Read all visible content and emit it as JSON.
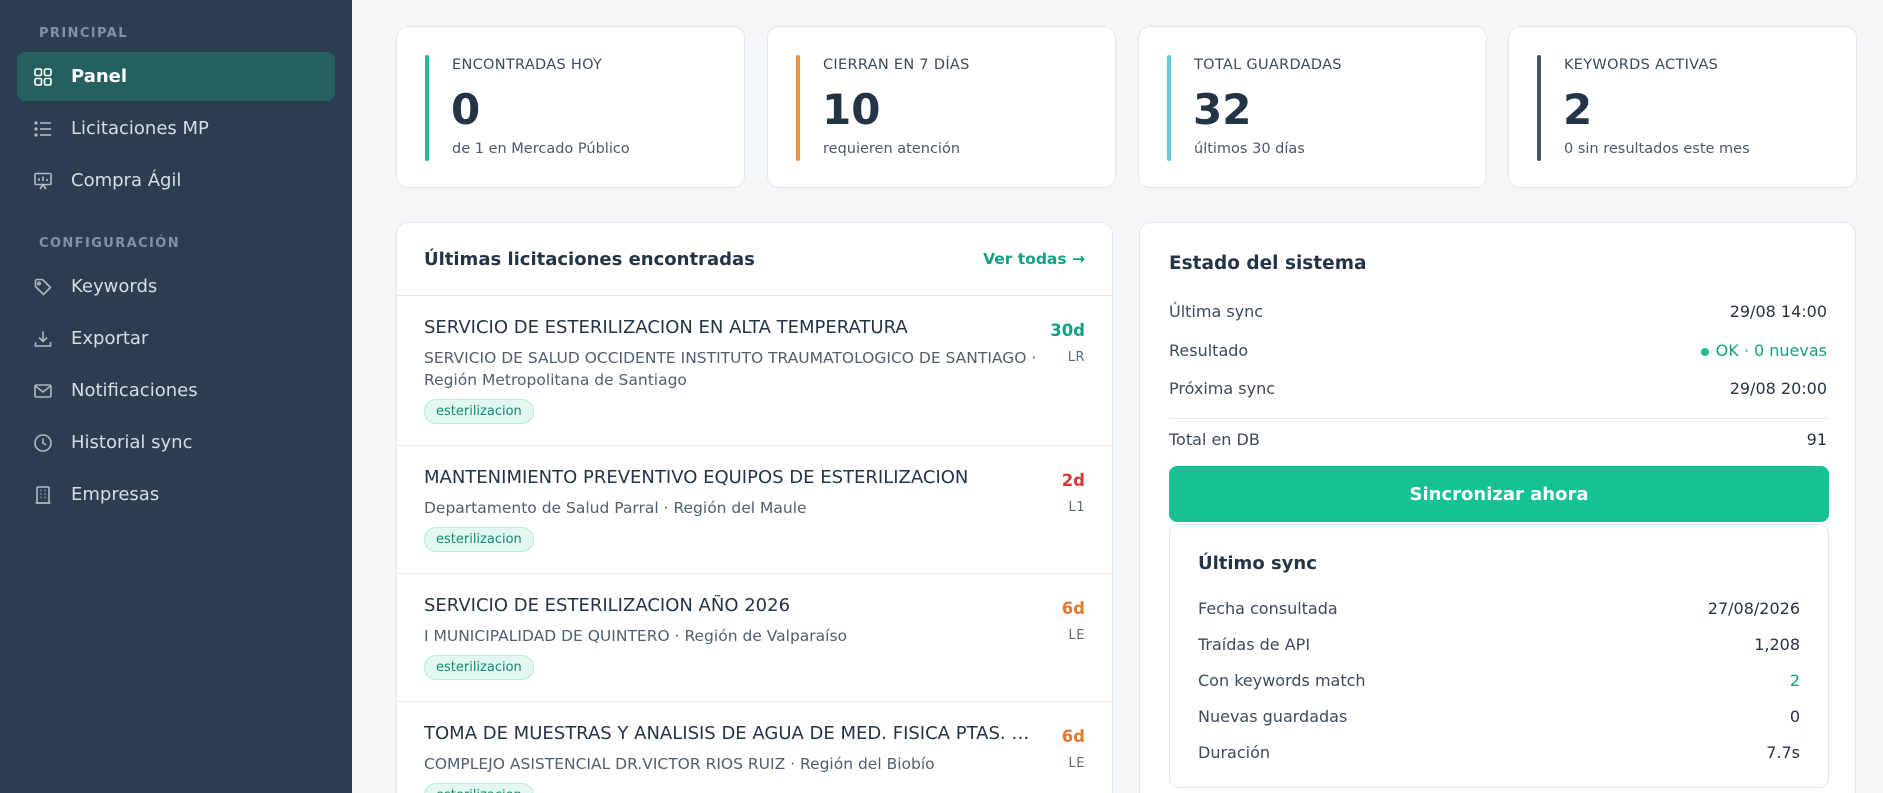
{
  "sidebar": {
    "sections": {
      "principal": "PRINCIPAL",
      "config": "CONFIGURACIÓN"
    },
    "items": [
      {
        "label": "Panel",
        "icon": "grid-icon",
        "active": true
      },
      {
        "label": "Licitaciones MP",
        "icon": "list-icon"
      },
      {
        "label": "Compra Ágil",
        "icon": "presentation-icon"
      },
      {
        "label": "Keywords",
        "icon": "tag-icon"
      },
      {
        "label": "Exportar",
        "icon": "download-icon"
      },
      {
        "label": "Notificaciones",
        "icon": "mail-icon"
      },
      {
        "label": "Historial sync",
        "icon": "clock-icon"
      },
      {
        "label": "Empresas",
        "icon": "building-icon"
      }
    ]
  },
  "stats": [
    {
      "label": "ENCONTRADAS HOY",
      "value": "0",
      "sub": "de 1 en Mercado Público",
      "color": "#1bbf8e"
    },
    {
      "label": "CIERRAN EN 7 DÍAS",
      "value": "10",
      "sub": "requieren atención",
      "color": "#f0913f"
    },
    {
      "label": "TOTAL GUARDADAS",
      "value": "32",
      "sub": "últimos 30 días",
      "color": "#67cbe0"
    },
    {
      "label": "KEYWORDS ACTIVAS",
      "value": "2",
      "sub": "0 sin resultados este mes",
      "color": "#445566"
    }
  ],
  "latest": {
    "title": "Últimas licitaciones encontradas",
    "view_all": "Ver todas →",
    "items": [
      {
        "title": "SERVICIO DE ESTERILIZACION EN ALTA TEMPERATURA",
        "org": "SERVICIO DE SALUD OCCIDENTE INSTITUTO TRAUMATOLOGICO DE SANTIAGO · Región Metropolitana de Santiago",
        "tag": "esterilizacion",
        "days": "30d",
        "days_color": "#14a083",
        "type": "LR"
      },
      {
        "title": "MANTENIMIENTO PREVENTIVO EQUIPOS DE ESTERILIZACION",
        "org": "Departamento de Salud Parral · Región del Maule",
        "tag": "esterilizacion",
        "days": "2d",
        "days_color": "#d63a3a",
        "type": "L1"
      },
      {
        "title": "SERVICIO DE ESTERILIZACION AÑO 2026",
        "org": "I MUNICIPALIDAD DE QUINTERO · Región de Valparaíso",
        "tag": "esterilizacion",
        "days": "6d",
        "days_color": "#e5782b",
        "type": "LE"
      },
      {
        "title": "TOMA DE MUESTRAS Y ANALISIS DE AGUA DE MED. FISICA PTAS. DE...",
        "org": "COMPLEJO ASISTENCIAL DR.VICTOR RIOS RUIZ · Región del Biobío",
        "tag": "esterilizacion",
        "days": "6d",
        "days_color": "#e5782b",
        "type": "LE"
      }
    ]
  },
  "system": {
    "title": "Estado del sistema",
    "last_sync_label": "Última sync",
    "last_sync_value": "29/08 14:00",
    "result_label": "Resultado",
    "result_value": "OK · 0 nuevas",
    "next_sync_label": "Próxima sync",
    "next_sync_value": "29/08 20:00",
    "total_label": "Total en DB",
    "total_value": "91",
    "sync_button": "Sincronizar ahora",
    "last": {
      "title": "Último sync",
      "rows": [
        {
          "label": "Fecha consultada",
          "value": "27/08/2026"
        },
        {
          "label": "Traídas de API",
          "value": "1,208"
        },
        {
          "label": "Con keywords match",
          "value": "2"
        },
        {
          "label": "Nuevas guardadas",
          "value": "0"
        },
        {
          "label": "Duración",
          "value": "7.7s"
        }
      ]
    }
  }
}
